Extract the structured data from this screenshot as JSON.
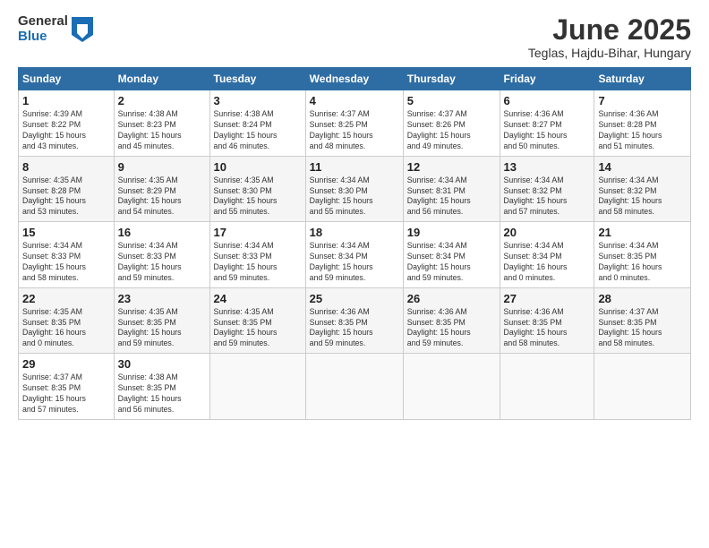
{
  "logo": {
    "general": "General",
    "blue": "Blue"
  },
  "title": "June 2025",
  "subtitle": "Teglas, Hajdu-Bihar, Hungary",
  "headers": [
    "Sunday",
    "Monday",
    "Tuesday",
    "Wednesday",
    "Thursday",
    "Friday",
    "Saturday"
  ],
  "weeks": [
    [
      {
        "day": "1",
        "info": "Sunrise: 4:39 AM\nSunset: 8:22 PM\nDaylight: 15 hours\nand 43 minutes."
      },
      {
        "day": "2",
        "info": "Sunrise: 4:38 AM\nSunset: 8:23 PM\nDaylight: 15 hours\nand 45 minutes."
      },
      {
        "day": "3",
        "info": "Sunrise: 4:38 AM\nSunset: 8:24 PM\nDaylight: 15 hours\nand 46 minutes."
      },
      {
        "day": "4",
        "info": "Sunrise: 4:37 AM\nSunset: 8:25 PM\nDaylight: 15 hours\nand 48 minutes."
      },
      {
        "day": "5",
        "info": "Sunrise: 4:37 AM\nSunset: 8:26 PM\nDaylight: 15 hours\nand 49 minutes."
      },
      {
        "day": "6",
        "info": "Sunrise: 4:36 AM\nSunset: 8:27 PM\nDaylight: 15 hours\nand 50 minutes."
      },
      {
        "day": "7",
        "info": "Sunrise: 4:36 AM\nSunset: 8:28 PM\nDaylight: 15 hours\nand 51 minutes."
      }
    ],
    [
      {
        "day": "8",
        "info": "Sunrise: 4:35 AM\nSunset: 8:28 PM\nDaylight: 15 hours\nand 53 minutes."
      },
      {
        "day": "9",
        "info": "Sunrise: 4:35 AM\nSunset: 8:29 PM\nDaylight: 15 hours\nand 54 minutes."
      },
      {
        "day": "10",
        "info": "Sunrise: 4:35 AM\nSunset: 8:30 PM\nDaylight: 15 hours\nand 55 minutes."
      },
      {
        "day": "11",
        "info": "Sunrise: 4:34 AM\nSunset: 8:30 PM\nDaylight: 15 hours\nand 55 minutes."
      },
      {
        "day": "12",
        "info": "Sunrise: 4:34 AM\nSunset: 8:31 PM\nDaylight: 15 hours\nand 56 minutes."
      },
      {
        "day": "13",
        "info": "Sunrise: 4:34 AM\nSunset: 8:32 PM\nDaylight: 15 hours\nand 57 minutes."
      },
      {
        "day": "14",
        "info": "Sunrise: 4:34 AM\nSunset: 8:32 PM\nDaylight: 15 hours\nand 58 minutes."
      }
    ],
    [
      {
        "day": "15",
        "info": "Sunrise: 4:34 AM\nSunset: 8:33 PM\nDaylight: 15 hours\nand 58 minutes."
      },
      {
        "day": "16",
        "info": "Sunrise: 4:34 AM\nSunset: 8:33 PM\nDaylight: 15 hours\nand 59 minutes."
      },
      {
        "day": "17",
        "info": "Sunrise: 4:34 AM\nSunset: 8:33 PM\nDaylight: 15 hours\nand 59 minutes."
      },
      {
        "day": "18",
        "info": "Sunrise: 4:34 AM\nSunset: 8:34 PM\nDaylight: 15 hours\nand 59 minutes."
      },
      {
        "day": "19",
        "info": "Sunrise: 4:34 AM\nSunset: 8:34 PM\nDaylight: 15 hours\nand 59 minutes."
      },
      {
        "day": "20",
        "info": "Sunrise: 4:34 AM\nSunset: 8:34 PM\nDaylight: 16 hours\nand 0 minutes."
      },
      {
        "day": "21",
        "info": "Sunrise: 4:34 AM\nSunset: 8:35 PM\nDaylight: 16 hours\nand 0 minutes."
      }
    ],
    [
      {
        "day": "22",
        "info": "Sunrise: 4:35 AM\nSunset: 8:35 PM\nDaylight: 16 hours\nand 0 minutes."
      },
      {
        "day": "23",
        "info": "Sunrise: 4:35 AM\nSunset: 8:35 PM\nDaylight: 15 hours\nand 59 minutes."
      },
      {
        "day": "24",
        "info": "Sunrise: 4:35 AM\nSunset: 8:35 PM\nDaylight: 15 hours\nand 59 minutes."
      },
      {
        "day": "25",
        "info": "Sunrise: 4:36 AM\nSunset: 8:35 PM\nDaylight: 15 hours\nand 59 minutes."
      },
      {
        "day": "26",
        "info": "Sunrise: 4:36 AM\nSunset: 8:35 PM\nDaylight: 15 hours\nand 59 minutes."
      },
      {
        "day": "27",
        "info": "Sunrise: 4:36 AM\nSunset: 8:35 PM\nDaylight: 15 hours\nand 58 minutes."
      },
      {
        "day": "28",
        "info": "Sunrise: 4:37 AM\nSunset: 8:35 PM\nDaylight: 15 hours\nand 58 minutes."
      }
    ],
    [
      {
        "day": "29",
        "info": "Sunrise: 4:37 AM\nSunset: 8:35 PM\nDaylight: 15 hours\nand 57 minutes."
      },
      {
        "day": "30",
        "info": "Sunrise: 4:38 AM\nSunset: 8:35 PM\nDaylight: 15 hours\nand 56 minutes."
      },
      {
        "day": "",
        "info": ""
      },
      {
        "day": "",
        "info": ""
      },
      {
        "day": "",
        "info": ""
      },
      {
        "day": "",
        "info": ""
      },
      {
        "day": "",
        "info": ""
      }
    ]
  ]
}
